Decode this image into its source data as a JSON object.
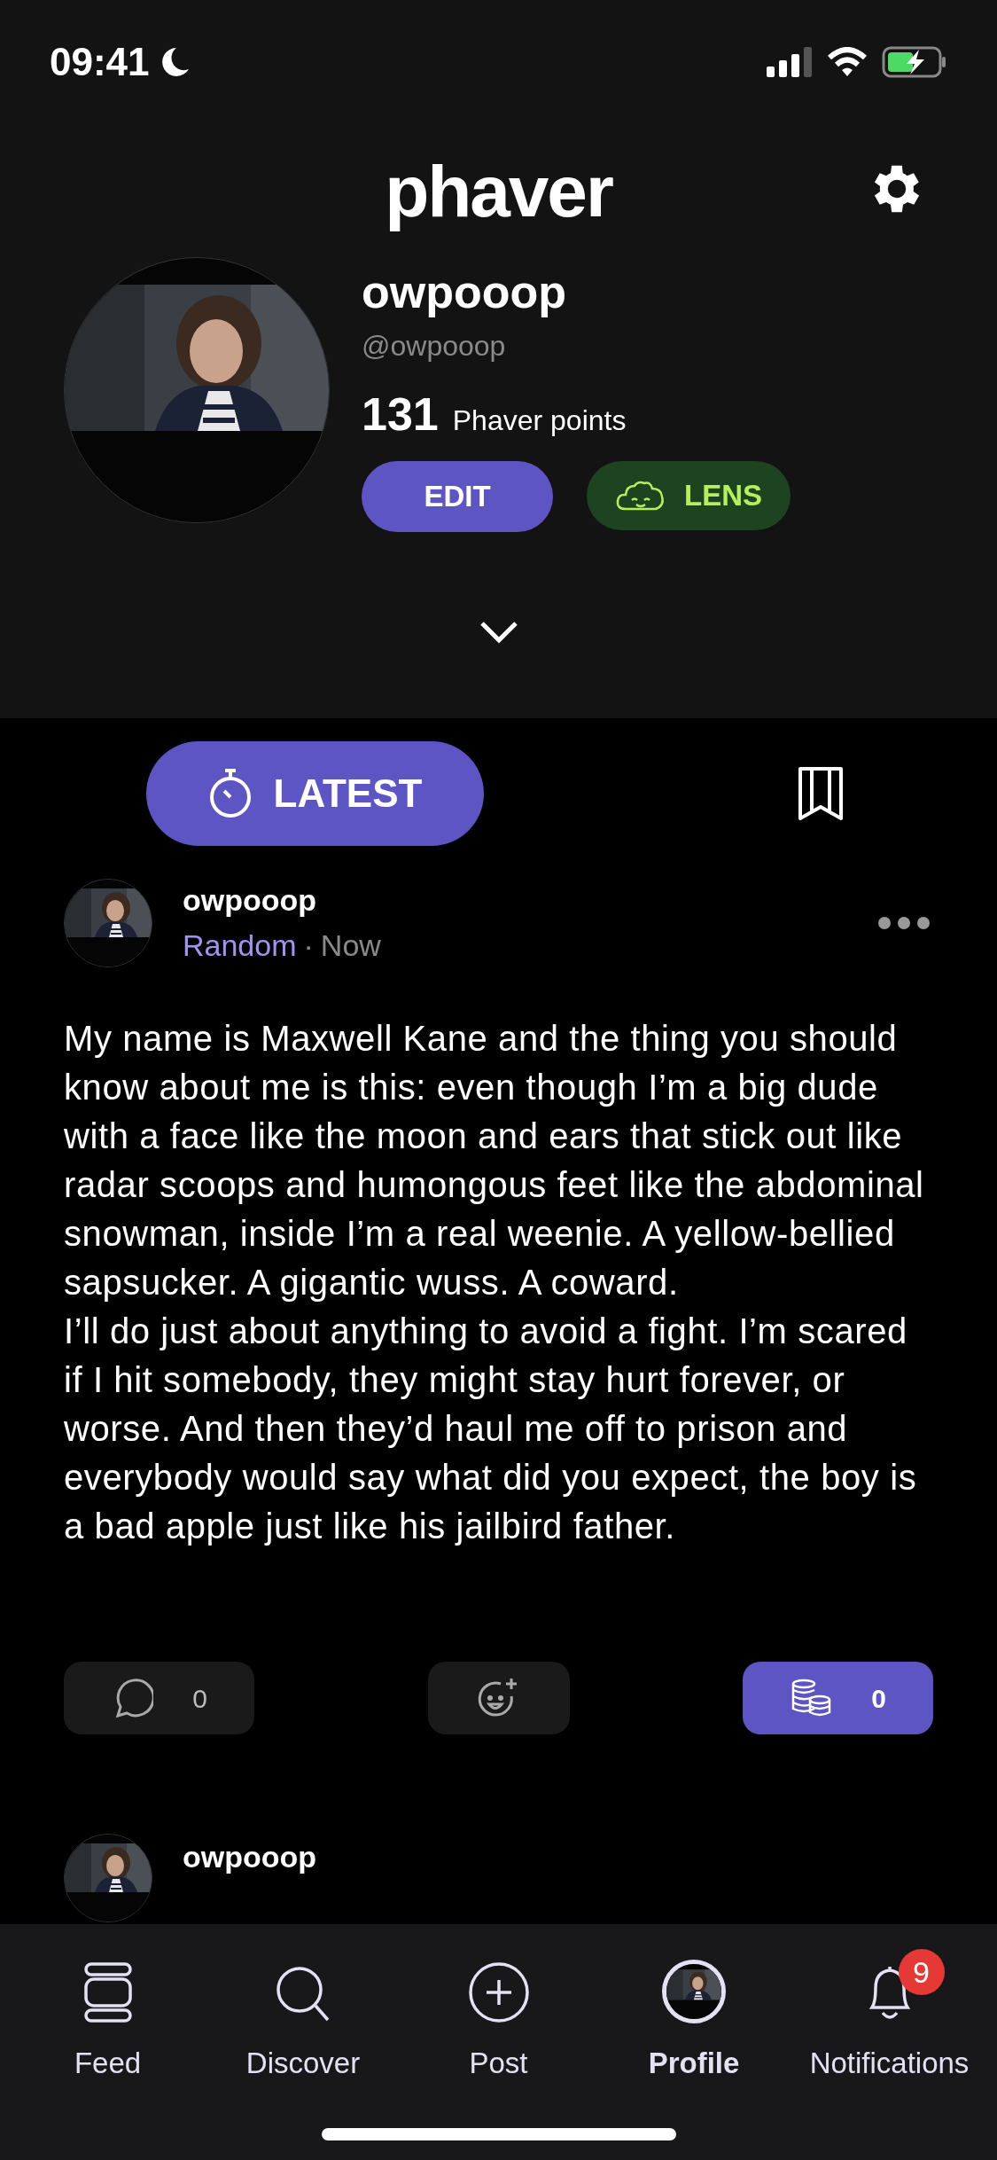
{
  "status_bar": {
    "time": "09:41"
  },
  "header": {
    "logo": "phaver"
  },
  "profile": {
    "name": "owpooop",
    "handle": "@owpooop",
    "points": "131",
    "points_label": "Phaver points",
    "buttons": [
      {
        "kind": "edit",
        "label": "EDIT"
      },
      {
        "kind": "lens",
        "label": "LENS"
      }
    ]
  },
  "tabs": [
    {
      "kind": "latest",
      "label": "LATEST",
      "selected": true
    },
    {
      "kind": "bookmarks",
      "selected": false
    }
  ],
  "posts": [
    {
      "author": "owpooop",
      "category": "Random",
      "separator": "·",
      "time": "Now",
      "paragraphs": [
        "My name is Maxwell Kane and the thing you should know about me is this: even though I’m a big dude with a face like the moon and ears that stick out like radar scoops and humongous feet like the abdominal snowman, inside I’m a real weenie. A yellow-bellied sapsucker. A gigantic wuss. A coward.",
        "I’ll do just about anything to avoid a fight. I’m scared if I hit somebody, they might stay hurt forever, or worse. And then they’d haul me off to prison and everybody would say what did you expect, the boy is a bad apple just like his jailbird father."
      ],
      "comments": "0",
      "tips": "0"
    }
  ],
  "next_post": {
    "author": "owpooop"
  },
  "nav": [
    {
      "kind": "feed",
      "label": "Feed",
      "selected": false
    },
    {
      "kind": "discover",
      "label": "Discover",
      "selected": false
    },
    {
      "kind": "post",
      "label": "Post",
      "selected": false
    },
    {
      "kind": "profile",
      "label": "Profile",
      "selected": true
    },
    {
      "kind": "notifications",
      "label": "Notifications",
      "selected": false,
      "badge": "9"
    }
  ]
}
